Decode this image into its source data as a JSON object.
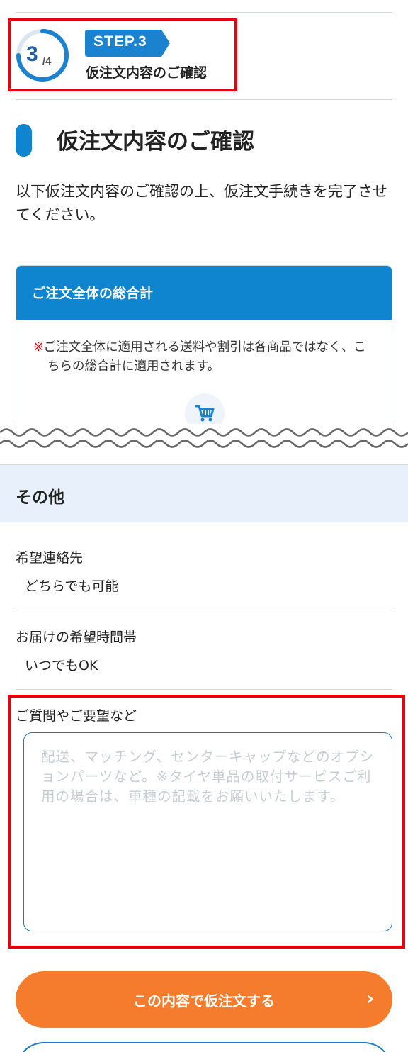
{
  "step": {
    "current": "3",
    "total": "/4",
    "badge": "STEP.3",
    "title": "仮注文内容のご確認",
    "progress_fraction": 0.75
  },
  "page": {
    "heading": "仮注文内容のご確認",
    "intro": "以下仮注文内容のご確認の上、仮注文手続きを完了させてください。"
  },
  "total_card": {
    "title": "ご注文全体の総合計",
    "note_mark": "※",
    "note": "ご注文全体に適用される送料や割引は各商品ではなく、こちらの総合計に適用されます。",
    "icon": "cart-icon"
  },
  "other": {
    "title": "その他",
    "fields": [
      {
        "label": "希望連絡先",
        "value": "どちらでも可能"
      },
      {
        "label": "お届けの希望時間帯",
        "value": "いつでもOK"
      }
    ],
    "request": {
      "label": "ご質問やご要望など",
      "value": "",
      "placeholder": "配送、マッチング、センターキャップなどのオプションパーツなど。※タイヤ単品の取付サービスご利用の場合は、車種の記載をお願いいたします。"
    }
  },
  "actions": {
    "submit_label": "この内容で仮注文する",
    "submit_chevron": "›"
  },
  "colors": {
    "primary": "#0f85d0",
    "accent": "#f57c2c",
    "highlight": "#e8000f",
    "section_bg": "#e8f1fb"
  }
}
